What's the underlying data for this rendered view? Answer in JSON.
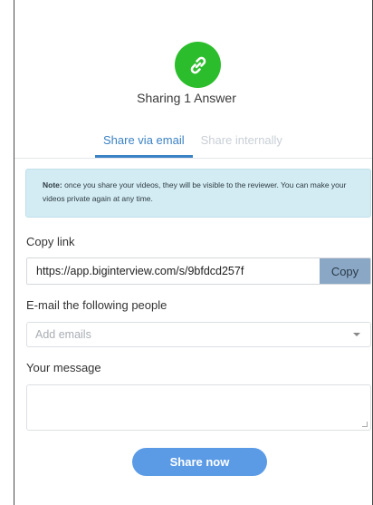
{
  "header": {
    "icon": "link-icon",
    "icon_color": "#2bbd2b",
    "title": "Sharing 1 Answer"
  },
  "tabs": [
    {
      "label": "Share via email",
      "active": true
    },
    {
      "label": "Share internally",
      "active": false
    }
  ],
  "note": {
    "prefix": "Note:",
    "text": " once you share your videos, they will be visible to the reviewer. You can make your videos private again at any time."
  },
  "copy_link": {
    "label": "Copy link",
    "url": "https://app.biginterview.com/s/9bfdcd257f",
    "button_label": "Copy"
  },
  "emails": {
    "label": "E-mail the following people",
    "placeholder": "Add emails"
  },
  "message": {
    "label": "Your message",
    "value": ""
  },
  "share_button": {
    "label": "Share now",
    "color": "#5b9be6"
  }
}
